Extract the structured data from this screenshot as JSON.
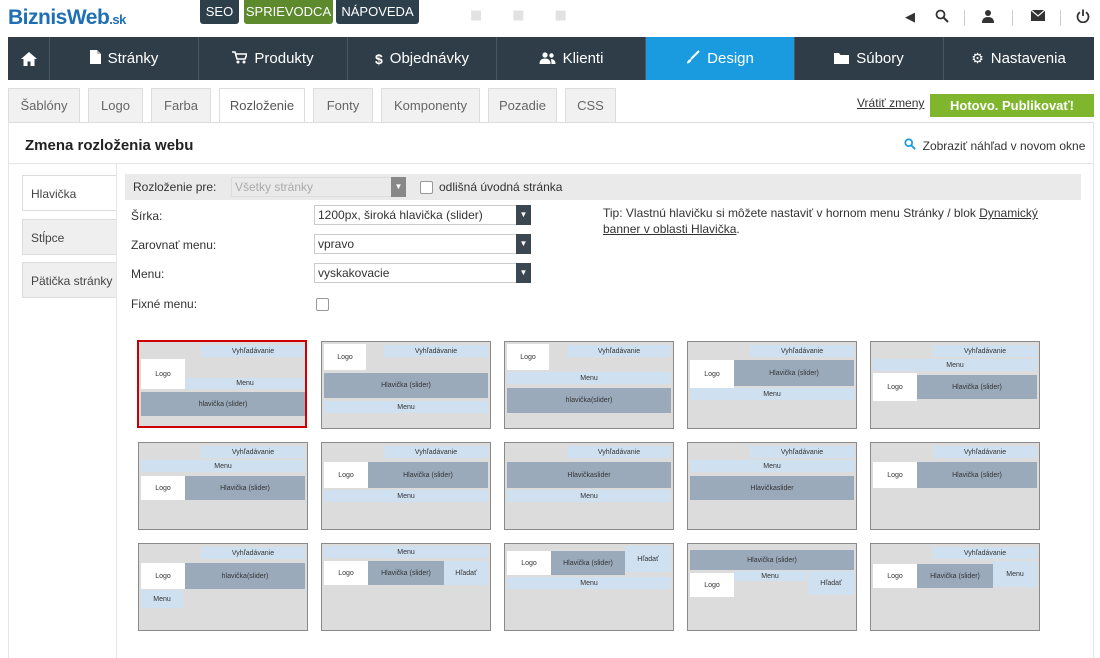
{
  "brand": {
    "name": "BiznisWeb",
    "suffix": ".sk",
    "color": "#1e6fb4"
  },
  "toplinks": {
    "seo": "SEO",
    "sprievodca": "SPRIEVODCA",
    "napoveda": "NÁPOVEDA"
  },
  "nav": {
    "home_icon": "home-icon",
    "items": [
      {
        "label": "Stránky",
        "icon": "file-icon"
      },
      {
        "label": "Produkty",
        "icon": "cart-icon"
      },
      {
        "label": "Objednávky",
        "icon": "dollar-icon"
      },
      {
        "label": "Klienti",
        "icon": "users-icon"
      },
      {
        "label": "Design",
        "icon": "brush-icon",
        "active": true
      },
      {
        "label": "Súbory",
        "icon": "folder-icon"
      },
      {
        "label": "Nastavenia",
        "icon": "gear-icon"
      }
    ],
    "active_color": "#1a9be0"
  },
  "tabs": [
    "Šablóny",
    "Logo",
    "Farba",
    "Rozloženie",
    "Fonty",
    "Komponenty",
    "Pozadie",
    "CSS"
  ],
  "actions": {
    "revert": "Vrátiť zmeny",
    "publish": "Hotovo. Publikovať!",
    "publish_color": "#7fb62d"
  },
  "page": {
    "title": "Zmena rozloženia webu",
    "preview": "Zobraziť náhľad v novom okne"
  },
  "sidenav": [
    "Hlavička",
    "Stĺpce",
    "Pätička stránky"
  ],
  "form": {
    "layout_label": "Rozloženie pre:",
    "layout_value": "Všetky stránky",
    "different_home": "odlišná úvodná stránka",
    "width_label": "Šírka:",
    "width_value": "1200px, široká hlavička (slider)",
    "align_label": "Zarovnať menu:",
    "align_value": "vpravo",
    "menu_label": "Menu:",
    "menu_value": "vyskakovacie",
    "fixed_label": "Fixné menu:"
  },
  "tip": {
    "text": "Tip: Vlastnú hlavičku si môžete nastaviť v hornom menu Stránky / blok ",
    "link": "Dynamický banner v oblasti Hlavička",
    "end": "."
  },
  "thumbs": {
    "t1": {
      "search": "Vyhľadávanie",
      "logo": "Logo",
      "menu": "Menu",
      "header": "hlavička (slider)"
    },
    "t2": {
      "logo": "Logo",
      "search": "Vyhľadávanie",
      "header": "Hlavička (slider)",
      "menu": "Menu"
    },
    "t3": {
      "logo": "Logo",
      "search": "Vyhľadávanie",
      "menu": "Menu",
      "header": "hlavička(slider)"
    },
    "t4": {
      "search": "Vyhľadávanie",
      "logo": "Logo",
      "header": "Hlavička (slider)",
      "menu": "Menu"
    },
    "t5": {
      "search": "Vyhľadávanie",
      "menu": "Menu",
      "logo": "Logo",
      "header": "Hlavička (slider)"
    },
    "t6": {
      "search": "Vyhľadávanie",
      "menu": "Menu",
      "logo": "Logo",
      "header": "Hlavička (slider)"
    },
    "t7": {
      "search": "Vyhľadávanie",
      "logo": "Logo",
      "header": "Hlavička (slider)",
      "menu": "Menu"
    },
    "t8": {
      "search": "Vyhľadávanie",
      "header": "Hlavičkaslider",
      "menu": "Menu"
    },
    "t9": {
      "search": "Vyhľadávanie",
      "menu": "Menu",
      "header": "Hlavičkaslider"
    },
    "t10": {
      "search": "Vyhľadávanie",
      "logo": "Logo",
      "header": "Hlavička (slider)"
    },
    "t11": {
      "search": "Vyhľadávanie",
      "logo": "Logo",
      "header": "hlavička(slider)",
      "menu": "Menu"
    },
    "t12": {
      "menu": "Menu",
      "logo": "Logo",
      "header": "Hlavička (slider)",
      "search": "Hľadať"
    },
    "t13": {
      "logo": "Logo",
      "header": "Hlavička (slider)",
      "search": "Hľadať",
      "menu": "Menu"
    },
    "t14": {
      "header": "Hlavička (slider)",
      "logo": "Logo",
      "menu": "Menu",
      "search": "Hľadať"
    },
    "t15": {
      "search": "Vyhľadávanie",
      "logo": "Logo",
      "header": "Hlavička (slider)",
      "menu": "Menu"
    }
  }
}
